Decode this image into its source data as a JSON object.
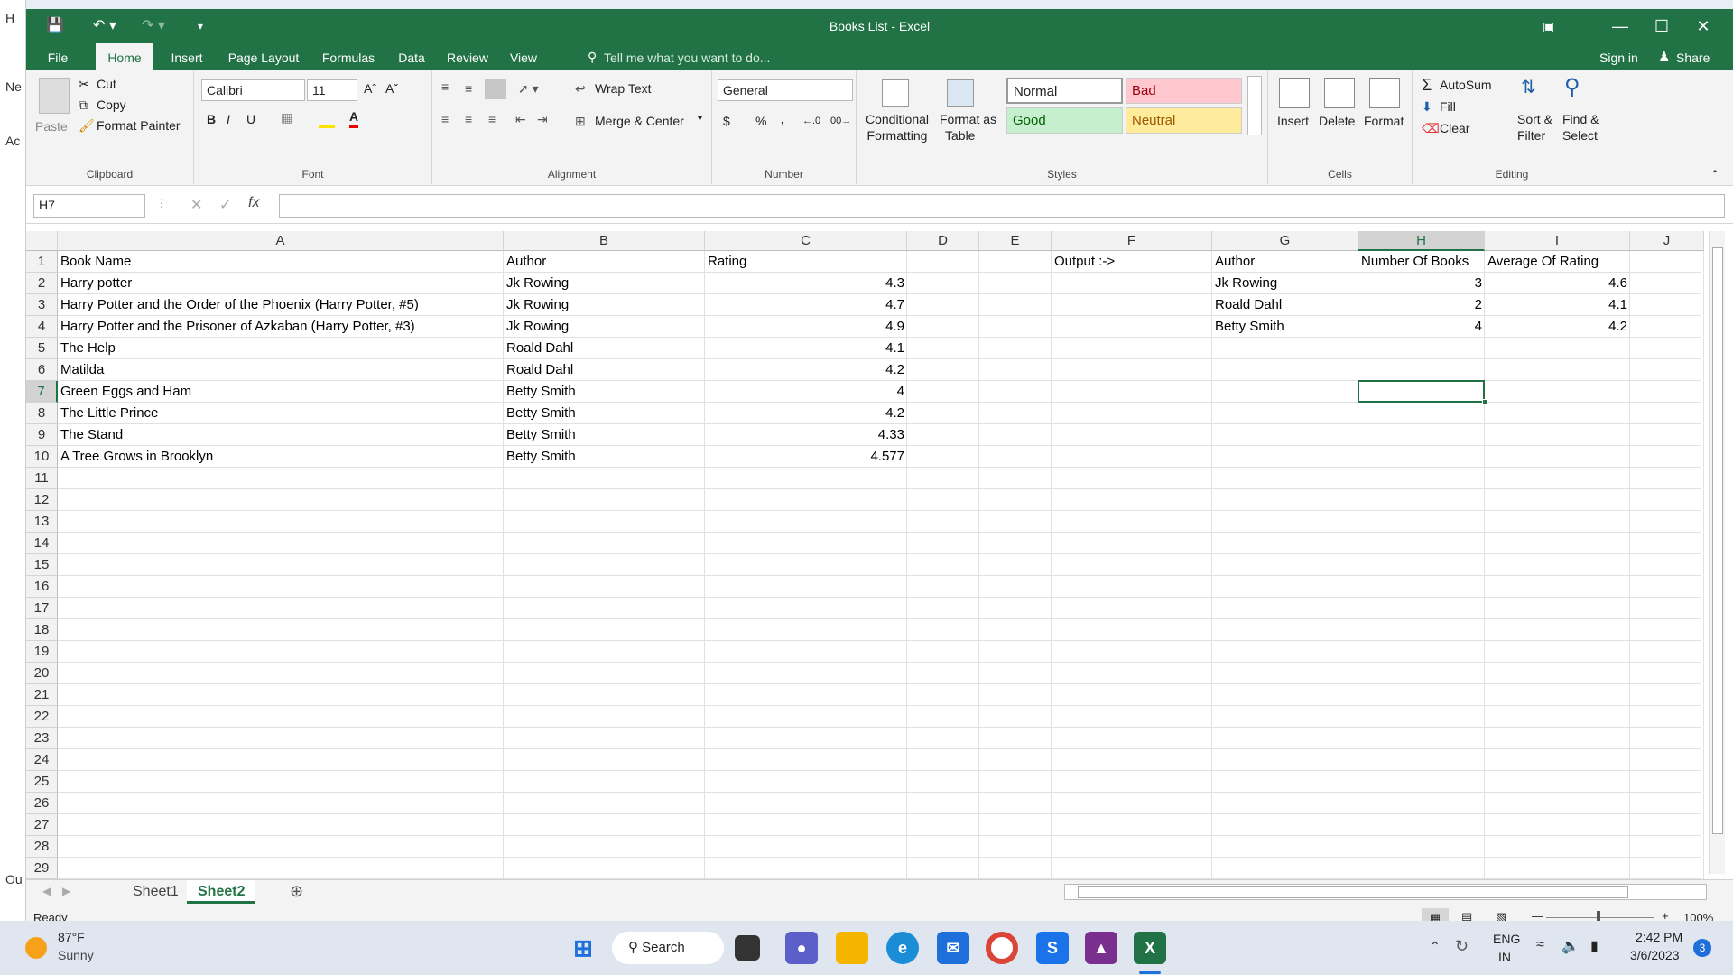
{
  "window": {
    "title": "Books List - Excel"
  },
  "left_strip": {
    "items": [
      "H",
      "Ne",
      "Ac",
      "Ou"
    ]
  },
  "tabs": [
    "File",
    "Home",
    "Insert",
    "Page Layout",
    "Formulas",
    "Data",
    "Review",
    "View"
  ],
  "tell_me": "Tell me what you want to do...",
  "sign_in": "Sign in",
  "share": "Share",
  "clipboard": {
    "paste": "Paste",
    "cut": "Cut",
    "copy": "Copy",
    "format_painter": "Format Painter",
    "label": "Clipboard"
  },
  "font": {
    "name": "Calibri",
    "size": "11",
    "label": "Font",
    "bold": "B",
    "italic": "I",
    "underline": "U"
  },
  "alignment": {
    "wrap_text": "Wrap Text",
    "merge_center": "Merge & Center",
    "label": "Alignment"
  },
  "number": {
    "format": "General",
    "label": "Number",
    "currency": "$",
    "percent": "%",
    "comma": ","
  },
  "styles": {
    "conditional": [
      "Conditional",
      "Formatting"
    ],
    "format_table": [
      "Format as",
      "Table"
    ],
    "normal": "Normal",
    "bad": "Bad",
    "good": "Good",
    "neutral": "Neutral",
    "label": "Styles"
  },
  "cells": {
    "insert": "Insert",
    "delete": "Delete",
    "format": "Format",
    "label": "Cells"
  },
  "editing": {
    "autosum": "AutoSum",
    "fill": "Fill",
    "clear": "Clear",
    "sort": [
      "Sort &",
      "Filter"
    ],
    "find": [
      "Find &",
      "Select"
    ],
    "label": "Editing"
  },
  "name_box": "H7",
  "formula": "",
  "columns": [
    "A",
    "B",
    "C",
    "D",
    "E",
    "F",
    "G",
    "H",
    "I",
    "J"
  ],
  "rows": [
    "1",
    "2",
    "3",
    "4",
    "5",
    "6",
    "7",
    "8",
    "9",
    "10",
    "11",
    "12",
    "13",
    "14",
    "15",
    "16",
    "17",
    "18",
    "19",
    "20",
    "21",
    "22",
    "23",
    "24",
    "25",
    "26",
    "27",
    "28",
    "29"
  ],
  "sheet": {
    "A": [
      "Book Name",
      "Harry potter",
      "Harry Potter and the Order of the Phoenix (Harry Potter, #5)",
      "Harry Potter and the Prisoner of Azkaban (Harry Potter, #3)",
      "The Help",
      "Matilda",
      "Green Eggs and Ham",
      "The Little Prince",
      "The Stand",
      "A Tree Grows in Brooklyn"
    ],
    "B": [
      "Author",
      "Jk Rowing",
      "Jk Rowing",
      "Jk Rowing",
      "Roald Dahl",
      "Roald Dahl",
      "Betty Smith",
      "Betty Smith",
      "Betty Smith",
      "Betty Smith"
    ],
    "C": [
      "Rating",
      "4.3",
      "4.7",
      "4.9",
      "4.1",
      "4.2",
      "4",
      "4.2",
      "4.33",
      "4.577"
    ],
    "F": [
      "Output :->"
    ],
    "G": [
      "Author",
      "Jk Rowing",
      "Roald Dahl",
      "Betty Smith"
    ],
    "H": [
      "Number Of Books",
      "3",
      "2",
      "4"
    ],
    "I": [
      "Average Of Rating",
      "4.6",
      "4.1",
      "4.2"
    ]
  },
  "sheet_tabs": [
    "Sheet1",
    "Sheet2"
  ],
  "active_sheet": "Sheet2",
  "status": {
    "ready": "Ready",
    "zoom": "100%"
  },
  "taskbar": {
    "weather_temp": "87°F",
    "weather_desc": "Sunny",
    "search": "Search",
    "lang": [
      "ENG",
      "IN"
    ],
    "time": "2:42 PM",
    "date": "3/6/2023",
    "notif": "3"
  }
}
